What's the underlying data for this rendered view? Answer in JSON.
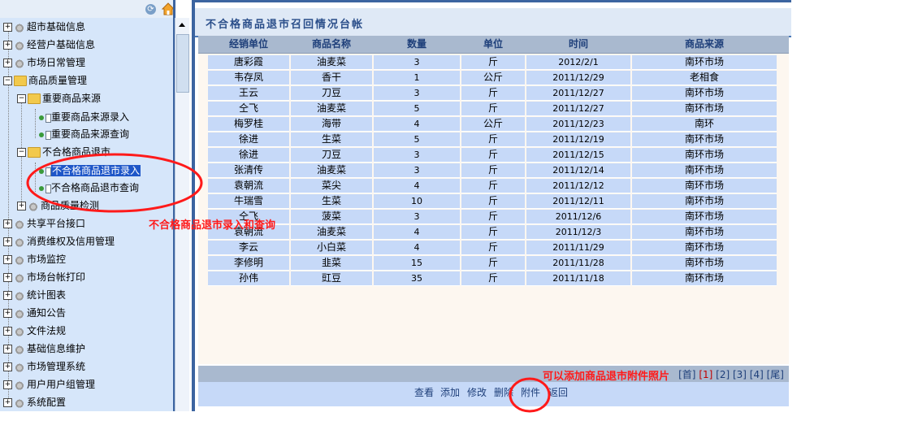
{
  "tree": {
    "items": [
      {
        "label": "超市基础信息"
      },
      {
        "label": "经营户基础信息"
      },
      {
        "label": "市场日常管理"
      },
      {
        "label": "商品质量管理"
      },
      {
        "label": "重要商品来源"
      },
      {
        "label": "重要商品来源录入"
      },
      {
        "label": "重要商品来源查询"
      },
      {
        "label": "不合格商品退市"
      },
      {
        "label": "不合格商品退市录入"
      },
      {
        "label": "不合格商品退市查询"
      },
      {
        "label": "商品质量检测"
      },
      {
        "label": "共享平台接口"
      },
      {
        "label": "消费维权及信用管理"
      },
      {
        "label": "市场监控"
      },
      {
        "label": "市场台帐打印"
      },
      {
        "label": "统计图表"
      },
      {
        "label": "通知公告"
      },
      {
        "label": "文件法规"
      },
      {
        "label": "基础信息维护"
      },
      {
        "label": "市场管理系统"
      },
      {
        "label": "用户用户组管理"
      },
      {
        "label": "系统配置"
      }
    ],
    "refresh_icon": "refresh-icon",
    "home_icon": "home-icon"
  },
  "main": {
    "title": "不合格商品退市召回情况台帐",
    "columns": [
      "经销单位",
      "商品名称",
      "数量",
      "单位",
      "时间",
      "商品来源"
    ],
    "rows": [
      [
        "唐彩霞",
        "油麦菜",
        "3",
        "斤",
        "2012/2/1",
        "南环市场"
      ],
      [
        "韦存凤",
        "香干",
        "1",
        "公斤",
        "2011/12/29",
        "老相食"
      ],
      [
        "王云",
        "刀豆",
        "3",
        "斤",
        "2011/12/27",
        "南环市场"
      ],
      [
        "仝飞",
        "油麦菜",
        "5",
        "斤",
        "2011/12/27",
        "南环市场"
      ],
      [
        "梅罗桂",
        "海带",
        "4",
        "公斤",
        "2011/12/23",
        "南环"
      ],
      [
        "徐进",
        "生菜",
        "5",
        "斤",
        "2011/12/19",
        "南环市场"
      ],
      [
        "徐进",
        "刀豆",
        "3",
        "斤",
        "2011/12/15",
        "南环市场"
      ],
      [
        "张清传",
        "油麦菜",
        "3",
        "斤",
        "2011/12/14",
        "南环市场"
      ],
      [
        "袁朝流",
        "菜尖",
        "4",
        "斤",
        "2011/12/12",
        "南环市场"
      ],
      [
        "牛瑞雪",
        "生菜",
        "10",
        "斤",
        "2011/12/11",
        "南环市场"
      ],
      [
        "仝飞",
        "菠菜",
        "3",
        "斤",
        "2011/12/6",
        "南环市场"
      ],
      [
        "袁朝流",
        "油麦菜",
        "4",
        "斤",
        "2011/12/3",
        "南环市场"
      ],
      [
        "李云",
        "小白菜",
        "4",
        "斤",
        "2011/11/29",
        "南环市场"
      ],
      [
        "李修明",
        "韭菜",
        "15",
        "斤",
        "2011/11/28",
        "南环市场"
      ],
      [
        "孙伟",
        "豇豆",
        "35",
        "斤",
        "2011/11/18",
        "南环市场"
      ]
    ],
    "pager": {
      "first": "[首]",
      "p1": "[1]",
      "p2": "[2]",
      "p3": "[3]",
      "p4": "[4]",
      "last": "[尾]"
    },
    "actions": {
      "view": "查看",
      "add": "添加",
      "edit": "修改",
      "delete": "删除",
      "attach": "附件",
      "back": "返回"
    }
  },
  "annotations": {
    "tree_note": "不合格商品退市录入和查询",
    "attach_note": "可以添加商品退市附件照片",
    "color": "#ff1a1a"
  }
}
